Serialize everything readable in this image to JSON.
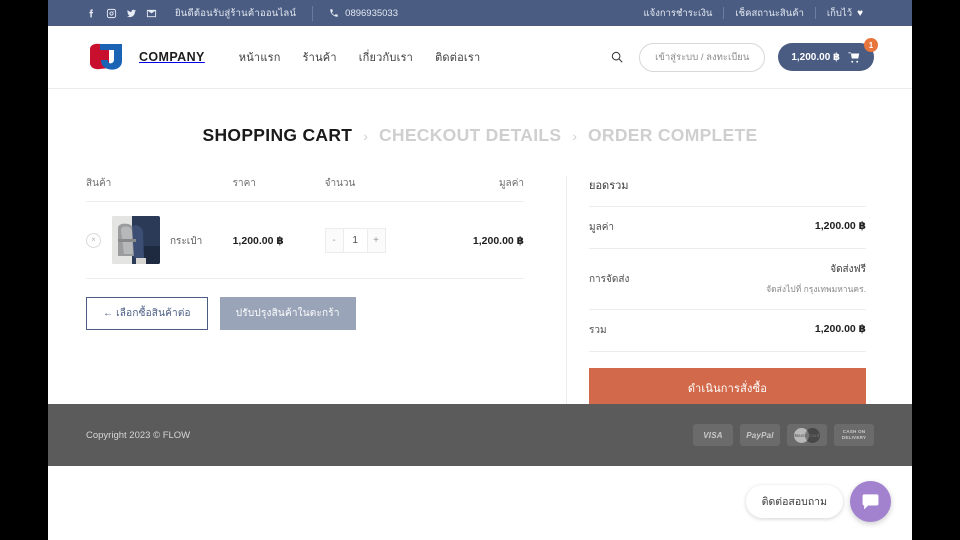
{
  "topbar": {
    "social": [
      "facebook-icon",
      "instagram-icon",
      "twitter-icon",
      "email-icon"
    ],
    "welcome": "ยินดีต้อนรับสู่ร้านค้าออนไลน์",
    "phone": "0896935033",
    "links": [
      "แจ้งการชำระเงิน",
      "เช็คสถานะสินค้า",
      "เก็บไว้"
    ],
    "bg_color": "#4a5c82"
  },
  "header": {
    "logo_text": "COMPANY",
    "nav": [
      "หน้าแรก",
      "ร้านค้า",
      "เกี่ยวกับเรา",
      "ติดต่อเรา"
    ],
    "login_label": "เข้าสู่ระบบ / ลงทะเบียน",
    "cart_total": "1,200.00 ฿",
    "cart_count": "1",
    "accent_color": "#4a5c82",
    "badge_color": "#e8763c"
  },
  "steps": [
    {
      "label": "SHOPPING CART",
      "state": "active"
    },
    {
      "label": "CHECKOUT DETAILS",
      "state": "inactive"
    },
    {
      "label": "ORDER COMPLETE",
      "state": "inactive"
    }
  ],
  "step_separator": "›",
  "cart": {
    "columns": [
      "สินค้า",
      "ราคา",
      "จำนวน",
      "มูลค่า"
    ],
    "items": [
      {
        "name": "กระเป๋า",
        "price": "1,200.00 ฿",
        "qty": "1",
        "subtotal": "1,200.00 ฿",
        "thumb_alt": "backpack-product-photo"
      }
    ],
    "qty_minus": "-",
    "qty_plus": "+",
    "remove_label": "×",
    "continue_button": "← เลือกซื้อสินค้าต่อ",
    "update_button": "ปรับปรุงสินค้าในตะกร้า"
  },
  "totals": {
    "title": "ยอดรวม",
    "subtotal_label": "มูลค่า",
    "subtotal_value": "1,200.00 ฿",
    "shipping_label": "การจัดส่ง",
    "shipping_value": "จัดส่งฟรี",
    "shipping_note": "จัดส่งไปที่ กรุงเทพมหานคร.",
    "total_label": "รวม",
    "total_value": "1,200.00 ฿",
    "checkout_button": "ดำเนินการสั่งซื้อ",
    "checkout_color": "#d2694a"
  },
  "footer": {
    "copyright": "Copyright 2023 © FLOW",
    "payments": [
      {
        "name": "visa-badge",
        "label": "VISA"
      },
      {
        "name": "paypal-badge",
        "label": "PayPal"
      },
      {
        "name": "mastercard-badge",
        "label": "MasterCard"
      },
      {
        "name": "cash-on-delivery-badge",
        "label": "CASH ON DELIVERY"
      }
    ],
    "bg_color": "#5b5b5b"
  },
  "chat": {
    "label": "ติดต่อสอบถาม",
    "button_color": "#a281ce"
  }
}
